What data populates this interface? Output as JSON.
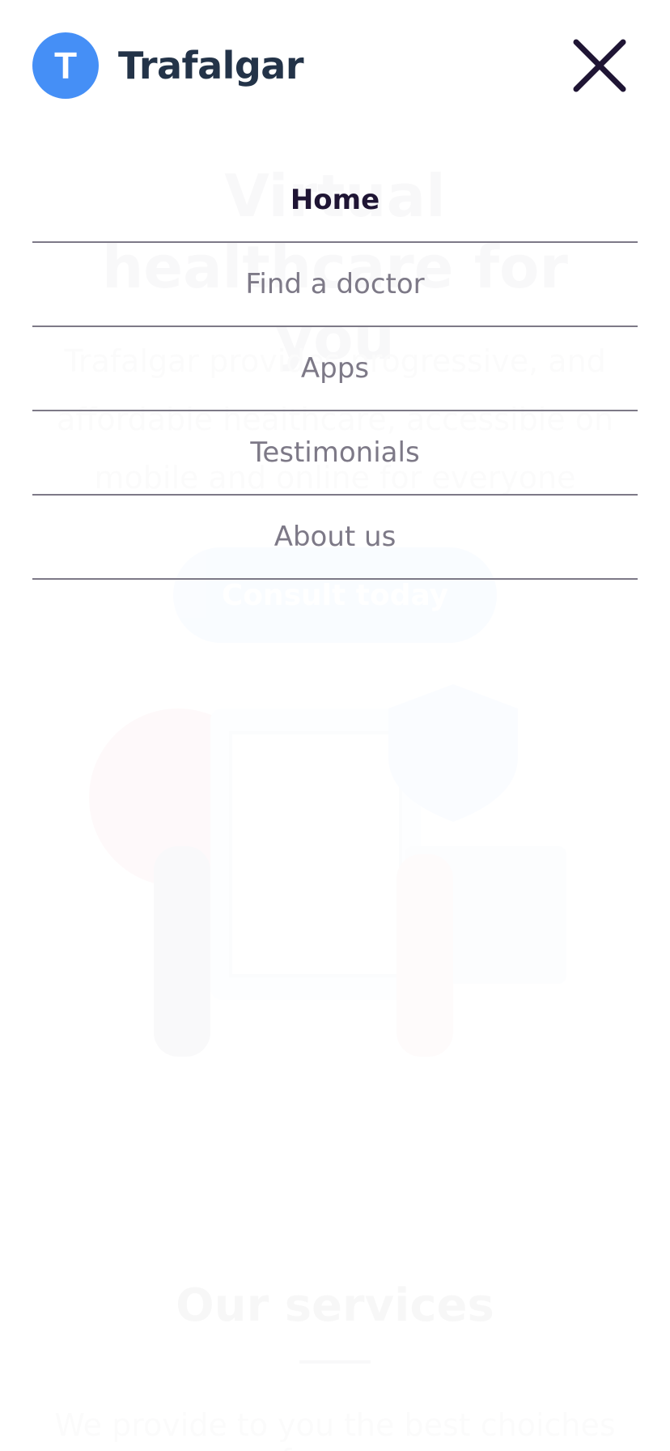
{
  "brand": {
    "initial": "T",
    "name": "Trafalgar",
    "accent_color": "#458ff6",
    "text_color": "#233348"
  },
  "close_button": {
    "icon": "close-icon",
    "color": "#1f1534"
  },
  "menu": {
    "items": [
      {
        "label": "Home",
        "active": true
      },
      {
        "label": "Find a doctor",
        "active": false
      },
      {
        "label": "Apps",
        "active": false
      },
      {
        "label": "Testimonials",
        "active": false
      },
      {
        "label": "About us",
        "active": false
      }
    ],
    "active_color": "#1f1534",
    "inactive_color": "#7d7987"
  },
  "background": {
    "hero_title": "Virtual healthcare for you",
    "hero_subtitle": "Trafalgar provides progressive, and affordable healthcare, accessible on mobile and online for everyone",
    "cta_label": "Consult today",
    "services_title": "Our services",
    "services_subtitle": "We provide to you the best choiches for you"
  }
}
